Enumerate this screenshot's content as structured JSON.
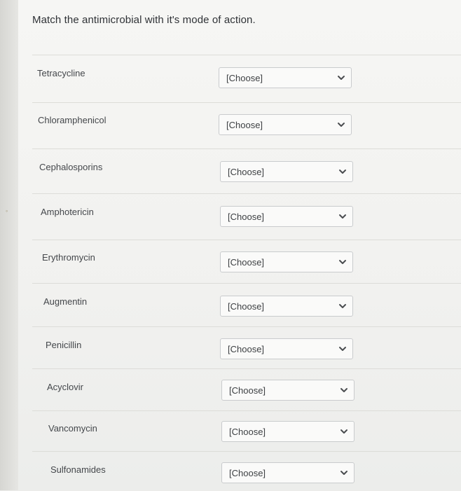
{
  "question": {
    "prompt": "Match the antimicrobial with it's mode of action."
  },
  "rows": [
    {
      "label": "Tetracycline",
      "selected": "[Choose]"
    },
    {
      "label": "Chloramphenicol",
      "selected": "[Choose]"
    },
    {
      "label": "Cephalosporins",
      "selected": "[Choose]"
    },
    {
      "label": "Amphotericin",
      "selected": "[Choose]"
    },
    {
      "label": "Erythromycin",
      "selected": "[Choose]"
    },
    {
      "label": "Augmentin",
      "selected": "[Choose]"
    },
    {
      "label": "Penicillin",
      "selected": "[Choose]"
    },
    {
      "label": "Acyclovir",
      "selected": "[Choose]"
    },
    {
      "label": "Vancomycin",
      "selected": "[Choose]"
    },
    {
      "label": "Sulfonamides",
      "selected": "[Choose]"
    }
  ],
  "icons": {
    "dropdown": "chevron-down-icon"
  }
}
